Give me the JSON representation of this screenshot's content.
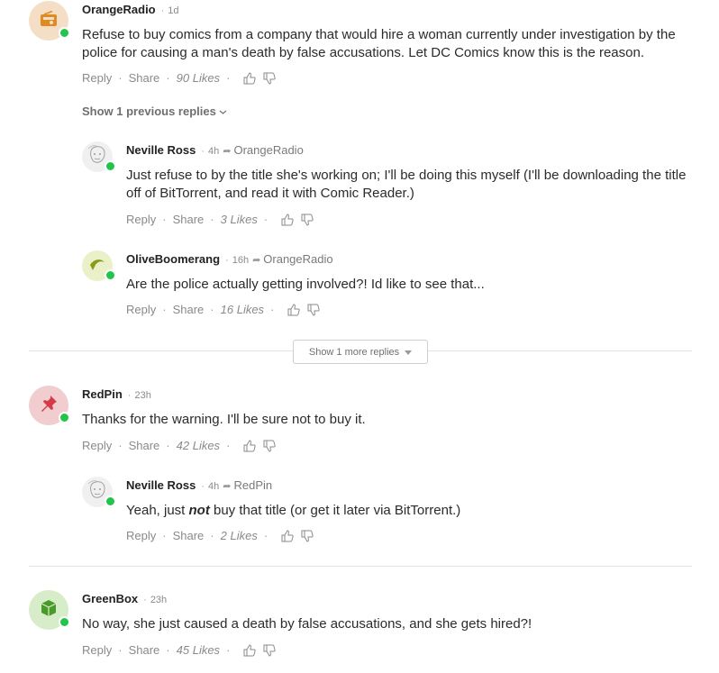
{
  "actions": {
    "reply": "Reply",
    "share": "Share"
  },
  "comments": [
    {
      "author": "OrangeRadio",
      "time": "1d",
      "reply_to": "",
      "text": "Refuse to buy comics from a company that would hire a woman currently under investigation by the police for causing a man's death by false accusations. Let DC Comics know this is the reason.",
      "likes": "90 Likes",
      "avatar_icon": "radio-icon",
      "avatar_bg": "#f4dfc6",
      "avatar_fg": "#e08a23"
    },
    {
      "author": "Neville Ross",
      "time": "4h",
      "reply_to": "OrangeRadio",
      "text": "Just refuse to by the title she's working on; I'll be doing this myself (I'll be downloading the title off of BitTorrent, and read it with Comic Reader.)",
      "likes": "3 Likes",
      "avatar_icon": "sketch-face-icon",
      "avatar_bg": "#f0f0f0",
      "avatar_fg": "#9a9a9a"
    },
    {
      "author": "OliveBoomerang",
      "time": "16h",
      "reply_to": "OrangeRadio",
      "text": "Are the police actually getting involved?! Id like to see that...",
      "likes": "16 Likes",
      "avatar_icon": "boomerang-icon",
      "avatar_bg": "#eaf0c8",
      "avatar_fg": "#8a9a1c"
    },
    {
      "author": "RedPin",
      "time": "23h",
      "reply_to": "",
      "text": "Thanks for the warning. I'll be sure not to buy it.",
      "likes": "42 Likes",
      "avatar_icon": "pushpin-icon",
      "avatar_bg": "#f2cdd0",
      "avatar_fg": "#d63a47"
    },
    {
      "author": "Neville Ross",
      "time": "4h",
      "reply_to": "RedPin",
      "text_before": "Yeah, just ",
      "text_emph": "not",
      "text_after": " buy that title (or get it later via BitTorrent.)",
      "likes": "2 Likes",
      "avatar_icon": "sketch-face-icon",
      "avatar_bg": "#f0f0f0",
      "avatar_fg": "#9a9a9a"
    },
    {
      "author": "GreenBox",
      "time": "23h",
      "reply_to": "",
      "text": "No way, she just caused a death by false accusations, and she gets hired?!",
      "likes": "45 Likes",
      "avatar_icon": "box-icon",
      "avatar_bg": "#d7edc9",
      "avatar_fg": "#4a9a2a"
    }
  ],
  "show_previous": "Show 1 previous replies",
  "show_more": "Show 1 more replies"
}
